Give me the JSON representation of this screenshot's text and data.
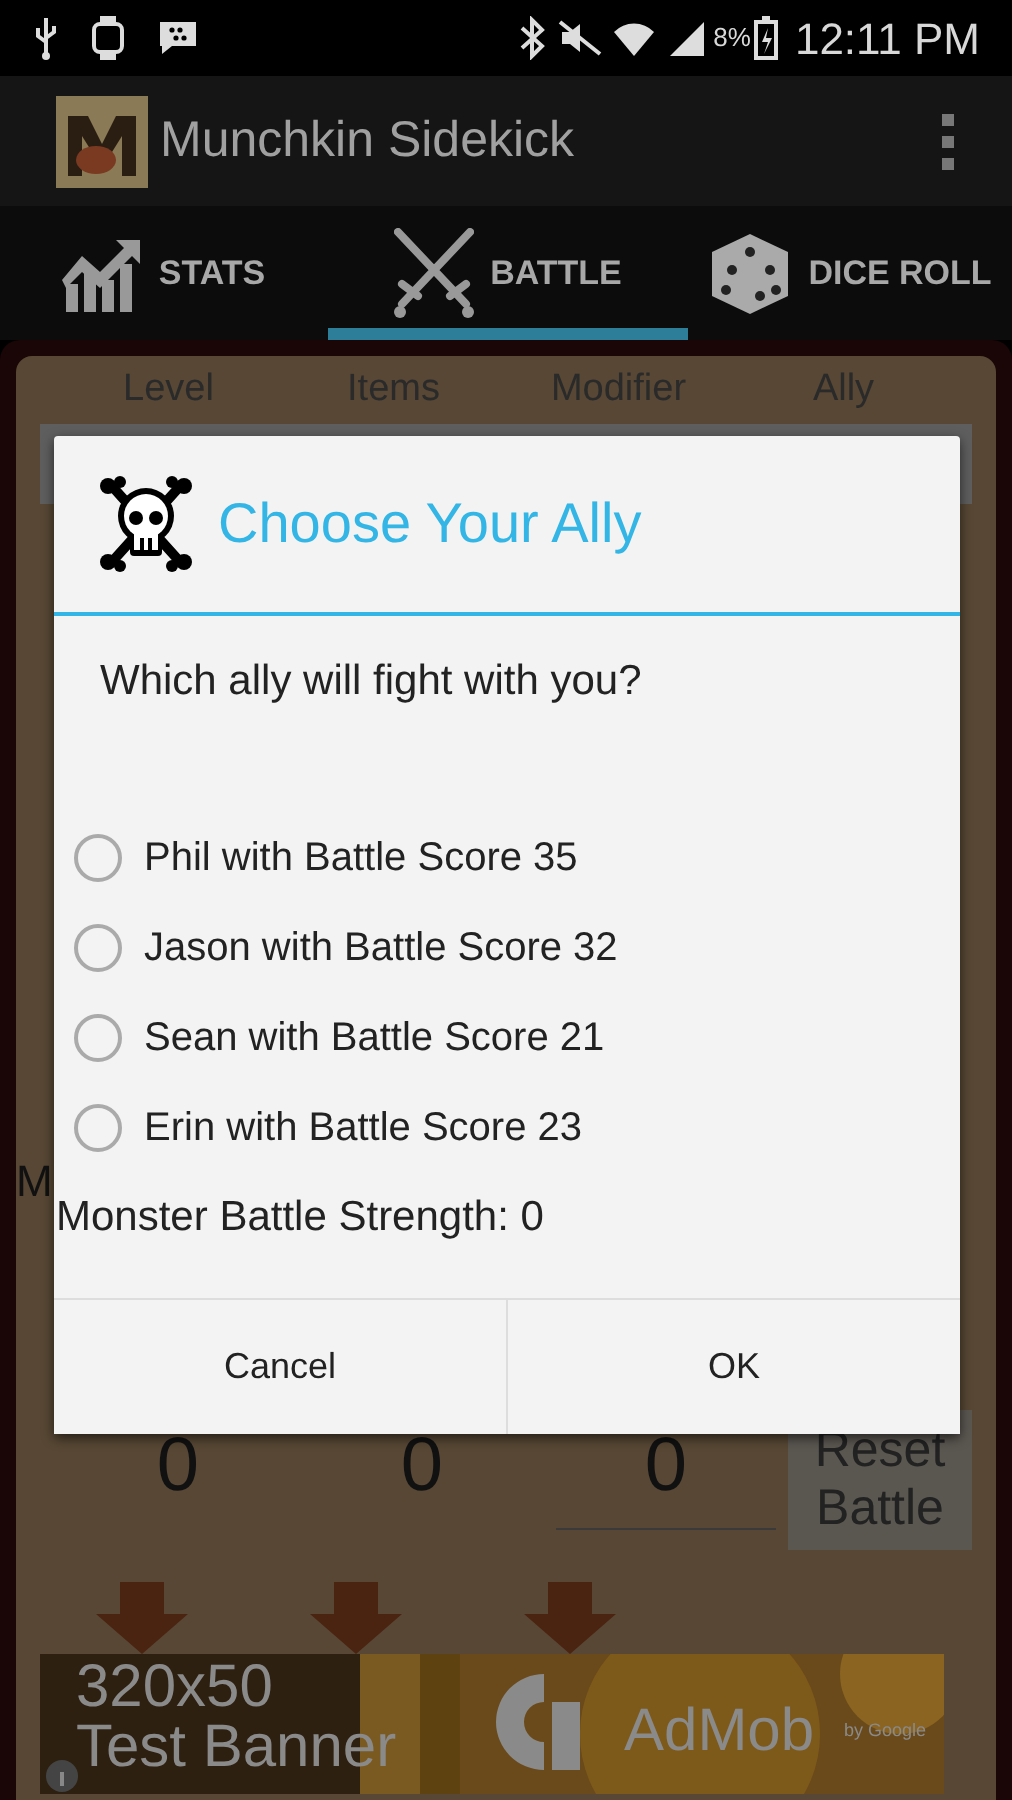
{
  "status_bar": {
    "battery": "8%",
    "time": "12:11 PM"
  },
  "app_bar": {
    "title": "Munchkin Sidekick"
  },
  "tabs": [
    {
      "label": "STATS",
      "selected": false
    },
    {
      "label": "BATTLE",
      "selected": true
    },
    {
      "label": "DICE ROLL",
      "selected": false
    }
  ],
  "battle": {
    "columns": [
      "Level",
      "Items",
      "Modifier",
      "Ally"
    ],
    "partial_label": "M",
    "values": [
      "0",
      "0",
      "0"
    ],
    "reset_button": "Reset Battle"
  },
  "ad": {
    "size": "320x50",
    "label": "Test Banner",
    "brand": "AdMob",
    "byline": "by Google"
  },
  "dialog": {
    "title": "Choose Your Ally",
    "question": "Which ally will fight with you?",
    "options": [
      {
        "label": "Phil with Battle Score 35",
        "selected": false
      },
      {
        "label": "Jason with Battle Score 32",
        "selected": false
      },
      {
        "label": "Sean with Battle Score 21",
        "selected": false
      },
      {
        "label": "Erin with Battle Score 23",
        "selected": false
      }
    ],
    "monster_strength": "Monster Battle Strength: 0",
    "buttons": [
      "Cancel",
      "OK"
    ]
  }
}
